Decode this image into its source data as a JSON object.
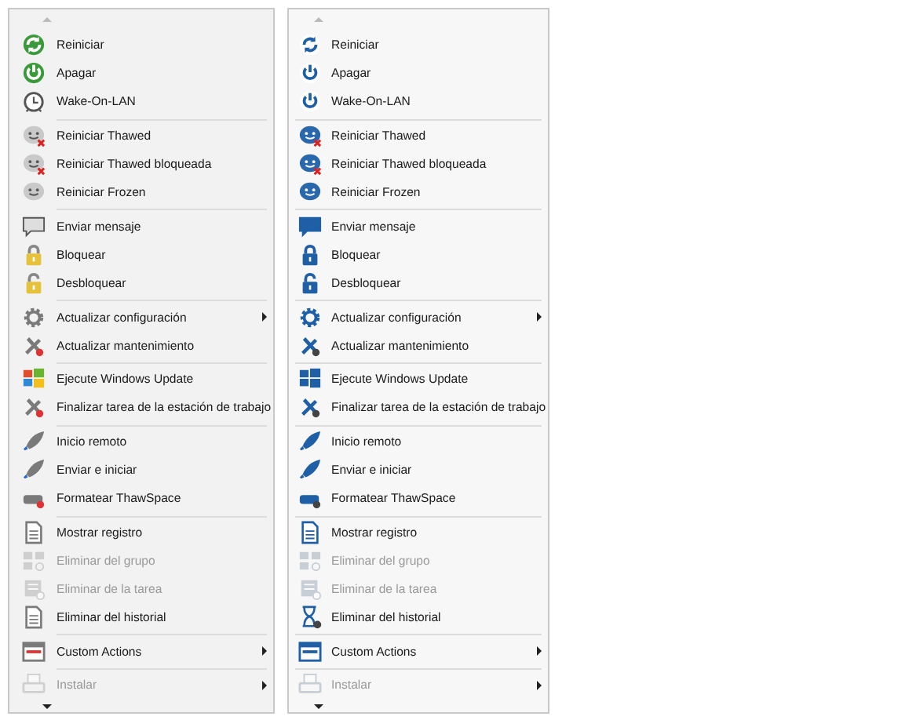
{
  "menus": [
    {
      "groups": [
        [
          {
            "label": "Reiniciar",
            "disabled": false,
            "submenu": false
          },
          {
            "label": "Apagar",
            "disabled": false,
            "submenu": false
          },
          {
            "label": "Wake-On-LAN",
            "disabled": false,
            "submenu": false
          }
        ],
        [
          {
            "label": "Reiniciar Thawed",
            "disabled": false,
            "submenu": false
          },
          {
            "label": "Reiniciar Thawed bloqueada",
            "disabled": false,
            "submenu": false
          },
          {
            "label": "Reiniciar Frozen",
            "disabled": false,
            "submenu": false
          }
        ],
        [
          {
            "label": "Enviar mensaje",
            "disabled": false,
            "submenu": false
          },
          {
            "label": "Bloquear",
            "disabled": false,
            "submenu": false
          },
          {
            "label": "Desbloquear",
            "disabled": false,
            "submenu": false
          }
        ],
        [
          {
            "label": "Actualizar configuración",
            "disabled": false,
            "submenu": true
          },
          {
            "label": "Actualizar mantenimiento",
            "disabled": false,
            "submenu": false
          }
        ],
        [
          {
            "label": "Ejecute Windows Update",
            "disabled": false,
            "submenu": false
          },
          {
            "label": "Finalizar tarea de la estación de trabajo",
            "disabled": false,
            "submenu": false
          }
        ],
        [
          {
            "label": "Inicio remoto",
            "disabled": false,
            "submenu": false
          },
          {
            "label": "Enviar e iniciar",
            "disabled": false,
            "submenu": false
          },
          {
            "label": "Formatear ThawSpace",
            "disabled": false,
            "submenu": false
          }
        ],
        [
          {
            "label": "Mostrar registro",
            "disabled": false,
            "submenu": false
          },
          {
            "label": "Eliminar del grupo",
            "disabled": true,
            "submenu": false
          },
          {
            "label": "Eliminar de la tarea",
            "disabled": true,
            "submenu": false
          },
          {
            "label": "Eliminar del historial",
            "disabled": false,
            "submenu": false
          }
        ],
        [
          {
            "label": "Custom Actions",
            "disabled": false,
            "submenu": true
          }
        ],
        [
          {
            "label": "Instalar",
            "disabled": true,
            "submenu": true
          }
        ]
      ]
    },
    {
      "groups": [
        [
          {
            "label": "Reiniciar",
            "disabled": false,
            "submenu": false
          },
          {
            "label": "Apagar",
            "disabled": false,
            "submenu": false
          },
          {
            "label": "Wake-On-LAN",
            "disabled": false,
            "submenu": false
          }
        ],
        [
          {
            "label": "Reiniciar Thawed",
            "disabled": false,
            "submenu": false
          },
          {
            "label": "Reiniciar Thawed bloqueada",
            "disabled": false,
            "submenu": false
          },
          {
            "label": "Reiniciar Frozen",
            "disabled": false,
            "submenu": false
          }
        ],
        [
          {
            "label": "Enviar mensaje",
            "disabled": false,
            "submenu": false
          },
          {
            "label": "Bloquear",
            "disabled": false,
            "submenu": false
          },
          {
            "label": "Desbloquear",
            "disabled": false,
            "submenu": false
          }
        ],
        [
          {
            "label": "Actualizar configuración",
            "disabled": false,
            "submenu": true
          },
          {
            "label": "Actualizar mantenimiento",
            "disabled": false,
            "submenu": false
          }
        ],
        [
          {
            "label": "Ejecute Windows Update",
            "disabled": false,
            "submenu": false
          },
          {
            "label": "Finalizar tarea de la estación de trabajo",
            "disabled": false,
            "submenu": false
          }
        ],
        [
          {
            "label": "Inicio remoto",
            "disabled": false,
            "submenu": false
          },
          {
            "label": "Enviar e iniciar",
            "disabled": false,
            "submenu": false
          },
          {
            "label": "Formatear ThawSpace",
            "disabled": false,
            "submenu": false
          }
        ],
        [
          {
            "label": "Mostrar registro",
            "disabled": false,
            "submenu": false
          },
          {
            "label": "Eliminar del grupo",
            "disabled": true,
            "submenu": false
          },
          {
            "label": "Eliminar de la tarea",
            "disabled": true,
            "submenu": false
          },
          {
            "label": "Eliminar del historial",
            "disabled": false,
            "submenu": false
          }
        ],
        [
          {
            "label": "Custom Actions",
            "disabled": false,
            "submenu": true
          }
        ],
        [
          {
            "label": "Instalar",
            "disabled": true,
            "submenu": true
          }
        ]
      ]
    }
  ]
}
